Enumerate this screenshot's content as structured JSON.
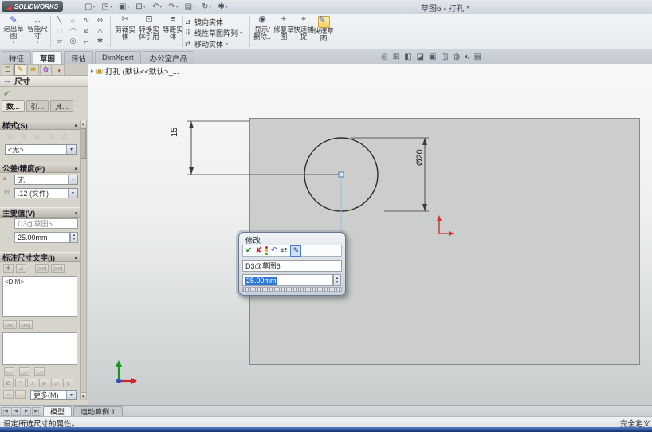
{
  "window": {
    "brand": "SOLIDWORKS",
    "title": "草图6 - 打孔 *"
  },
  "icons": {
    "chevron_down": "▾",
    "pm_title_icon": "↔",
    "check": "✔",
    "scroll_up": "▲",
    "scroll_down": "▼",
    "spin_up": "▴",
    "spin_down": "▾",
    "tree_expand": "▸",
    "part_cube": "▣"
  },
  "quick_access": [
    "▢",
    "◳",
    "▣",
    "⊟",
    "↶",
    "↷",
    "▤",
    "↻",
    "✱"
  ],
  "ribbon": {
    "exit_sketch": {
      "icon": "✎",
      "l1": "退出草",
      "l2": "图"
    },
    "smart_dimension": {
      "icon": "↔",
      "l1": "智能尺",
      "l2": "寸"
    },
    "sketch_tools": [
      "╲",
      "○",
      "∿",
      "⊕",
      "□",
      "◠",
      "⌀",
      "△",
      "▱",
      "◎",
      "⌐",
      "✱"
    ],
    "trim": {
      "icon": "✂",
      "l1": "剪裁实",
      "l2": "体"
    },
    "convert": {
      "icon": "⊡",
      "l1": "转换实",
      "l2": "体引用"
    },
    "offset": {
      "icon": "≡",
      "l1": "等距实",
      "l2": "体"
    },
    "mirror": {
      "icon": "⊿",
      "label": "镜向实体"
    },
    "pattern": {
      "icon": "⠿",
      "label": "线性草图阵列"
    },
    "move": {
      "icon": "⇄",
      "label": "移动实体"
    },
    "display_delete": {
      "icon": "◉",
      "l1": "显示/",
      "l2": "删除.."
    },
    "repair": {
      "icon": "+",
      "l1": "修复草",
      "l2": "图"
    },
    "snap": {
      "icon": "⌖",
      "l1": "快速捕",
      "l2": "捉"
    },
    "quick_sketch": {
      "icon": "✎",
      "l1": "快速草",
      "l2": "图"
    }
  },
  "command_tabs": [
    "特征",
    "草图",
    "评估",
    "DimXpert",
    "办公室产品"
  ],
  "view_toolbar": [
    "◎",
    "⊞",
    "◧",
    "◪",
    "▣",
    "◫",
    "◍",
    "◐",
    "▤"
  ],
  "tree_label": "打孔 (默认<<默认>_...",
  "pm": {
    "title": "尺寸",
    "tabs": [
      "数...",
      "引...",
      "其..."
    ],
    "style": {
      "title": "样式(S)",
      "icons": [
        "☆",
        "☆",
        "☆",
        "☆",
        "☆"
      ],
      "value": "<无>"
    },
    "tolerance": {
      "title": "公差/精度(P)",
      "rows": [
        {
          "icon": "±",
          "value": "无"
        },
        {
          "icon": ".12",
          "value": ".12 (文件)"
        }
      ]
    },
    "primary": {
      "title": "主要值(V)",
      "icon": "↔",
      "name": "D3@草图6",
      "value": "25.00mm"
    },
    "dim_text": {
      "title": "标注尺寸文字(I)",
      "toolbar": [
        "✱",
        "⊿",
        "(xx)",
        "(xx)"
      ],
      "text": "<DIM>",
      "row2": [
        "(xx)",
        "(xx)"
      ],
      "row3": [
        "▭",
        "▭",
        "▭"
      ],
      "symbols": [
        "Ø",
        "°",
        "±",
        "⌀",
        "▱",
        "∨"
      ],
      "symbols2": [
        "⌐",
        "⌣"
      ],
      "more": "更多(M)"
    }
  },
  "modify": {
    "title": "修改",
    "increment_icon": "±?",
    "name": "D3@草图6",
    "value": "25.00mm"
  },
  "sketch": {
    "dim_vertical": "15",
    "dim_diameter": "Ø20"
  },
  "bottom": {
    "nav": [
      "|◀",
      "◀",
      "▶",
      "▶|"
    ],
    "tabs": [
      "模型",
      "运动算例 1"
    ]
  },
  "status": {
    "left": "设定所选尺寸的属性。",
    "right": "完全定义"
  }
}
